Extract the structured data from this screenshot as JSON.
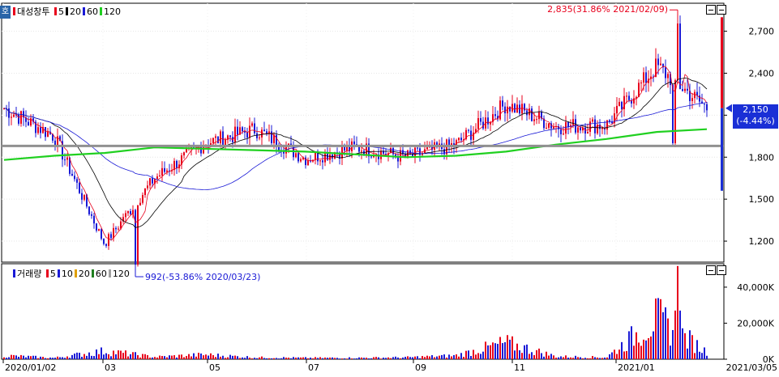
{
  "app": {
    "corner_icon": "호"
  },
  "price_panel": {
    "legend": {
      "name": "대성창투",
      "ma": [
        {
          "label": "5",
          "color": "#e8001c"
        },
        {
          "label": "20",
          "color": "#000000"
        },
        {
          "label": "60",
          "color": "#1a1ad6"
        },
        {
          "label": "120",
          "color": "#20d020"
        }
      ]
    },
    "y_ticks": [
      "2,700",
      "2,400",
      "2,100",
      "1,800",
      "1,500",
      "1,200"
    ],
    "current_price": "2,150",
    "current_change": "(-4.44%)",
    "high_annotation": "2,835(31.86% 2021/02/09)",
    "low_annotation": "992(-53.86% 2020/03/23)"
  },
  "volume_panel": {
    "legend": {
      "name": "거래량",
      "ma": [
        {
          "label": "5",
          "color": "#e8001c"
        },
        {
          "label": "10",
          "color": "#1a1ad6"
        },
        {
          "label": "20",
          "color": "#e0a000"
        },
        {
          "label": "60",
          "color": "#208020"
        },
        {
          "label": "120",
          "color": "#a0a0a0"
        }
      ]
    },
    "y_ticks": [
      "40,000K",
      "20,000K",
      "0K"
    ]
  },
  "x_axis": {
    "ticks": [
      "2020/01/02",
      "03",
      "05",
      "07",
      "09",
      "11",
      "2021/01"
    ],
    "end_label": "2021/03/05"
  },
  "chart_data": [
    {
      "type": "candlestick",
      "title": "대성창투",
      "ylim": [
        1050,
        2900
      ],
      "colors": {
        "up": "#e8001c",
        "down": "#1a1ad6",
        "ma5": "#e8001c",
        "ma20": "#000000",
        "ma60": "#1a1ad6",
        "ma120": "#20d020",
        "ref_line": "#909090"
      },
      "reference_line": 1880,
      "x": [
        "2020/01",
        "2020/02",
        "2020/03",
        "2020/04",
        "2020/05",
        "2020/06",
        "2020/07",
        "2020/08",
        "2020/09",
        "2020/10",
        "2020/11",
        "2020/12",
        "2021/01",
        "2021/02",
        "2021/03"
      ],
      "close": [
        2150,
        1950,
        1180,
        1650,
        1900,
        2000,
        1790,
        1870,
        1800,
        1890,
        2180,
        2020,
        2030,
        2450,
        2150
      ],
      "ma120": [
        1780,
        1810,
        1830,
        1870,
        1860,
        1850,
        1840,
        1820,
        1800,
        1810,
        1840,
        1890,
        1930,
        1980,
        2000
      ],
      "high": 2835,
      "low": 992
    },
    {
      "type": "bar",
      "title": "거래량",
      "ylim": [
        0,
        53000
      ],
      "x": [
        "2020/01",
        "2020/02",
        "2020/03",
        "2020/04",
        "2020/05",
        "2020/06",
        "2020/07",
        "2020/08",
        "2020/09",
        "2020/10",
        "2020/11",
        "2020/12",
        "2021/01",
        "2021/02",
        "2021/03"
      ],
      "values_k": [
        4000,
        1500,
        9000,
        2500,
        5000,
        2000,
        1500,
        1500,
        2000,
        4000,
        18000,
        3000,
        2000,
        45000,
        8000
      ]
    }
  ]
}
